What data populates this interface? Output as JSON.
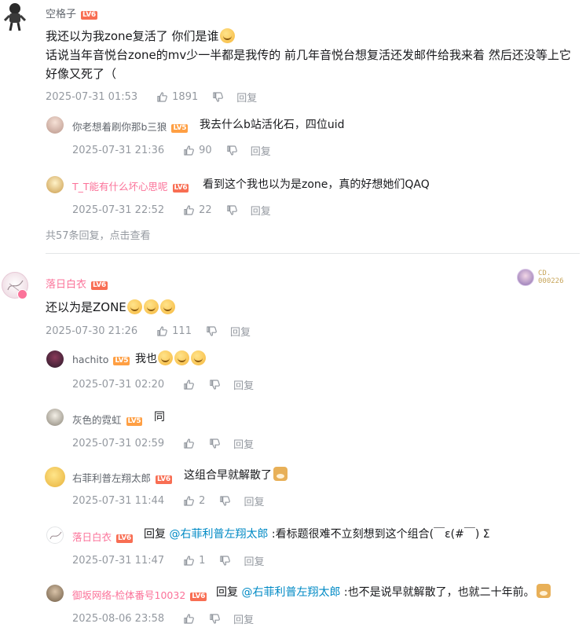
{
  "threads": [
    {
      "user": "空格子",
      "level": "LV6",
      "content_line1": "我还以为我zone复活了 你们是谁",
      "content_line2": "话说当年音悦台zone的mv少一半都是我传的 前几年音悦台想复活还发邮件给我来着 然后还没等上它好像又死了（",
      "time": "2025-07-31 01:53",
      "likes": "1891",
      "reply_label": "回复",
      "replies": [
        {
          "user": "你老想着刷你那b三狼",
          "level": "LV5",
          "content": "我去什么b站活化石，四位uid",
          "time": "2025-07-31 21:36",
          "likes": "90",
          "reply_label": "回复"
        },
        {
          "user": "T_T能有什么坏心思呢",
          "level": "LV6",
          "content": "看到这个我也以为是zone，真的好想她们QAQ",
          "time": "2025-07-31 22:52",
          "likes": "22",
          "reply_label": "回复"
        }
      ],
      "more_replies": "共57条回复，点击查看"
    },
    {
      "user": "落日白衣",
      "level": "LV6",
      "content": "还以为是ZONE",
      "time": "2025-07-30 21:26",
      "likes": "111",
      "reply_label": "回复",
      "fan_badge": {
        "line1": "CD.",
        "line2": "000226"
      },
      "replies": [
        {
          "user": "hachito",
          "level": "LV5",
          "content": "我也",
          "time": "2025-07-31 02:20",
          "likes": "",
          "reply_label": "回复"
        },
        {
          "user": "灰色的霓虹",
          "level": "LV5",
          "content": "同",
          "time": "2025-07-31 02:59",
          "likes": "",
          "reply_label": "回复"
        },
        {
          "user": "右菲利普左翔太郎",
          "level": "LV6",
          "content": "这组合早就解散了",
          "time": "2025-07-31 11:44",
          "likes": "2",
          "reply_label": "回复"
        },
        {
          "user": "落日白衣",
          "level": "LV6",
          "reply_prefix": "回复",
          "mention": "@右菲利普左翔太郎",
          "content": " :看标题很难不立刻想到这个组合(￣ε(#￣) Σ",
          "time": "2025-07-31 11:47",
          "likes": "1",
          "reply_label": "回复"
        },
        {
          "user": "御坂网络-检体番号10032",
          "level": "LV6",
          "reply_prefix": "回复",
          "mention": "@右菲利普左翔太郎",
          "content": " :也不是说早就解散了，也就二十年前。",
          "time": "2025-08-06 23:58",
          "likes": "",
          "reply_label": "回复"
        }
      ]
    }
  ],
  "colors": {
    "pink_name": "#fb7299",
    "meta_gray": "#9499a0",
    "link_blue": "#008ac5",
    "divider": "#e3e5e7"
  }
}
